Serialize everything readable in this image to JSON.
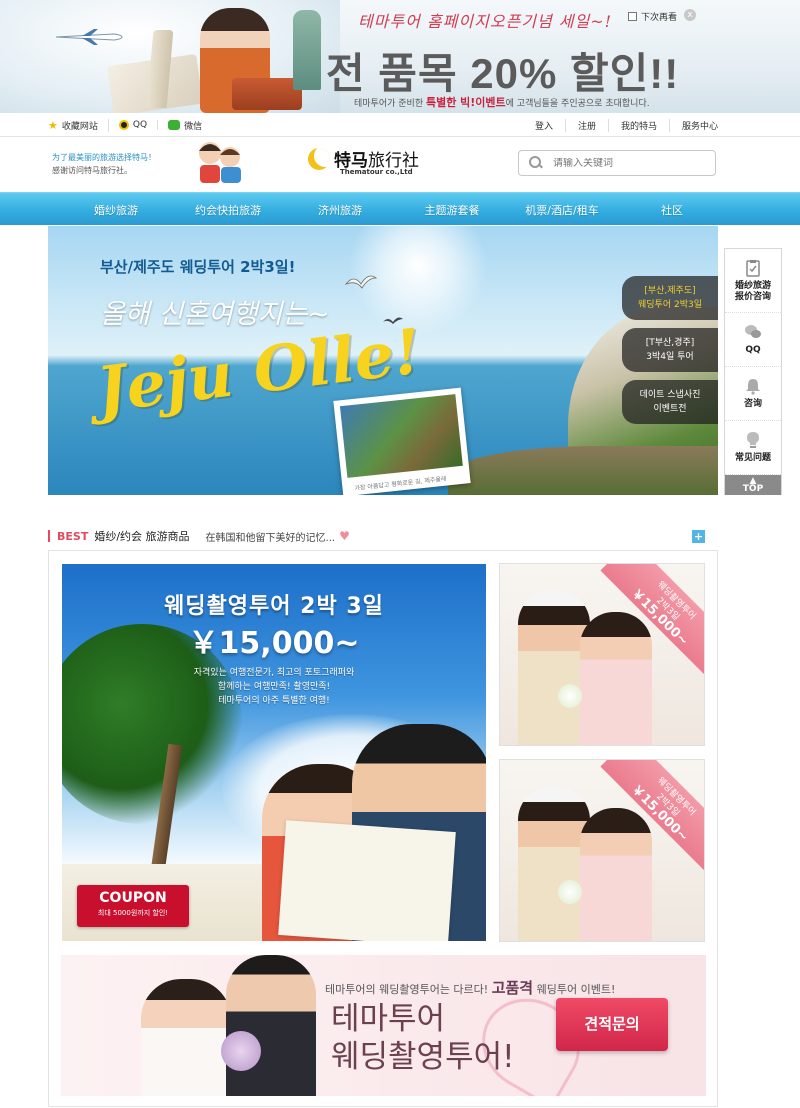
{
  "promo": {
    "line1": "테마투어 홈페이지오픈기념 세일~!",
    "line2": "전 품목 20% 할인!!",
    "line3_pre": "테마투어가 준비한 ",
    "line3_bold": "특별한 빅!이벤트",
    "line3_post": "에 고객님들을 주인공으로 초대합니다.",
    "no_more": "下次再看",
    "close": "x"
  },
  "utility": {
    "left": [
      "收藏网站",
      "QQ",
      "微信"
    ],
    "right": [
      "登入",
      "注册",
      "我的特马",
      "服务中心"
    ]
  },
  "header": {
    "slogan_1": "为了最美丽的旅游选择特马！",
    "slogan_2": "感谢访问特马旅行社。",
    "logo_bold": "特马",
    "logo_light": "旅行社",
    "logo_sub": "Thematour co.,Ltd",
    "search_placeholder": "请输入关键词"
  },
  "nav": [
    "婚纱旅游",
    "约会快拍旅游",
    "济州旅游",
    "主题游套餐",
    "机票/酒店/租车",
    "社区"
  ],
  "hero": {
    "subtitle": "부산/제주도 웨딩투어 2박3일!",
    "script": "올해 신혼여행지는~",
    "main": "Jeju Olle!",
    "photo_caption": "가장 아름답고 평화로운 길, 제주올레",
    "tabs": [
      {
        "l1": "[부산,제주도]",
        "l2": "웨딩투어 2박3일"
      },
      {
        "l1": "[T부산,경주]",
        "l2": "3박4일 투어"
      },
      {
        "l1": "데이트 스냅사진",
        "l2": "이벤트전"
      }
    ]
  },
  "sidebar": {
    "items": [
      {
        "l1": "婚纱旅游",
        "l2": "报价咨询"
      },
      {
        "l1": "QQ",
        "l2": ""
      },
      {
        "l1": "咨询",
        "l2": ""
      },
      {
        "l1": "常见问题",
        "l2": ""
      }
    ],
    "top": "TOP"
  },
  "section": {
    "best": "BEST",
    "title": "婚纱/约会 旅游商品",
    "slogan": "在韩国和他留下美好的记忆...",
    "heart": "♥",
    "plus": "+"
  },
  "main_product": {
    "title": "웨딩촬영투어 2박 3일",
    "price": "￥15,000~",
    "desc_1": "자격있는 여행전문가, 최고의 포토그래퍼와",
    "desc_2": "함께하는 여행만족! 촬영만족!",
    "desc_3": "테마투어의 아주 특별한 여행!",
    "coupon_title": "COUPON",
    "coupon_sub": "최대 5000원까지 할인!"
  },
  "side_products": [
    {
      "ribbon_l1": "웨딩촬영투어",
      "ribbon_l2": "2박3일",
      "ribbon_price": "￥15,000~"
    },
    {
      "ribbon_l1": "웨딩촬영투어",
      "ribbon_l2": "2박3일",
      "ribbon_price": "￥15,000~"
    }
  ],
  "bottom_banner": {
    "line1_pre": "테마투어의 웨딩촬영투어는 다르다! ",
    "line1_bold": "고품격",
    "line1_post": " 웨딩투어 이벤트!",
    "big_1": "테마투어",
    "big_2": "웨딩촬영투어!",
    "cta": "견적문의"
  },
  "colors": {
    "nav_blue": "#34ade0",
    "accent_red": "#e24a5e",
    "coupon_red": "#c8102e",
    "cta_pink": "#e43555",
    "price_yellow": "#f7d31e"
  }
}
